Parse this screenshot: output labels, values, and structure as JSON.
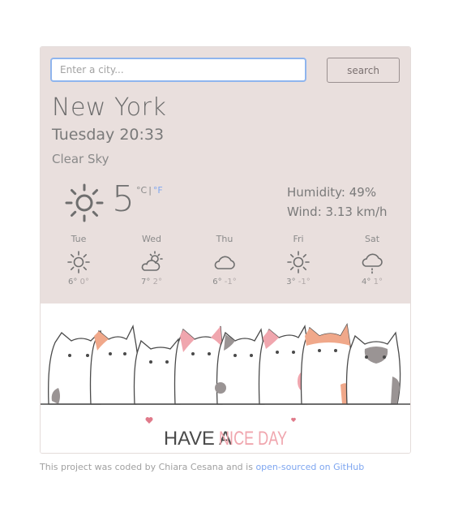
{
  "search": {
    "placeholder": "Enter a city...",
    "button_label": "search"
  },
  "current": {
    "city": "New York",
    "datetime": "Tuesday 20:33",
    "description": "Clear Sky",
    "icon": "sun-icon",
    "temperature": "5",
    "unit_celsius": "°C",
    "unit_separator": "|",
    "unit_fahrenheit": "°F",
    "humidity": "Humidity: 49%",
    "wind": "Wind: 3.13 km/h"
  },
  "forecast": [
    {
      "day": "Tue",
      "icon": "sun-icon",
      "max": "6°",
      "min": "0°"
    },
    {
      "day": "Wed",
      "icon": "cloud-sun-icon",
      "max": "7°",
      "min": "2°"
    },
    {
      "day": "Thu",
      "icon": "cloud-icon",
      "max": "6°",
      "min": "-1°"
    },
    {
      "day": "Fri",
      "icon": "sun-icon",
      "max": "3°",
      "min": "-1°"
    },
    {
      "day": "Sat",
      "icon": "cloud-drizzle-icon",
      "max": "4°",
      "min": "1°"
    }
  ],
  "illustration": {
    "text_1": "HAVE A",
    "text_2": "NICE DAY",
    "accent_color": "#f0a6ae"
  },
  "footer": {
    "text": "This project was coded by Chiara Cesana and is",
    "link_text": "open-sourced on GitHub"
  },
  "colors": {
    "panel_bg": "#e9dfdd",
    "link": "#7ea6f0",
    "text": "#6e6e6e"
  }
}
